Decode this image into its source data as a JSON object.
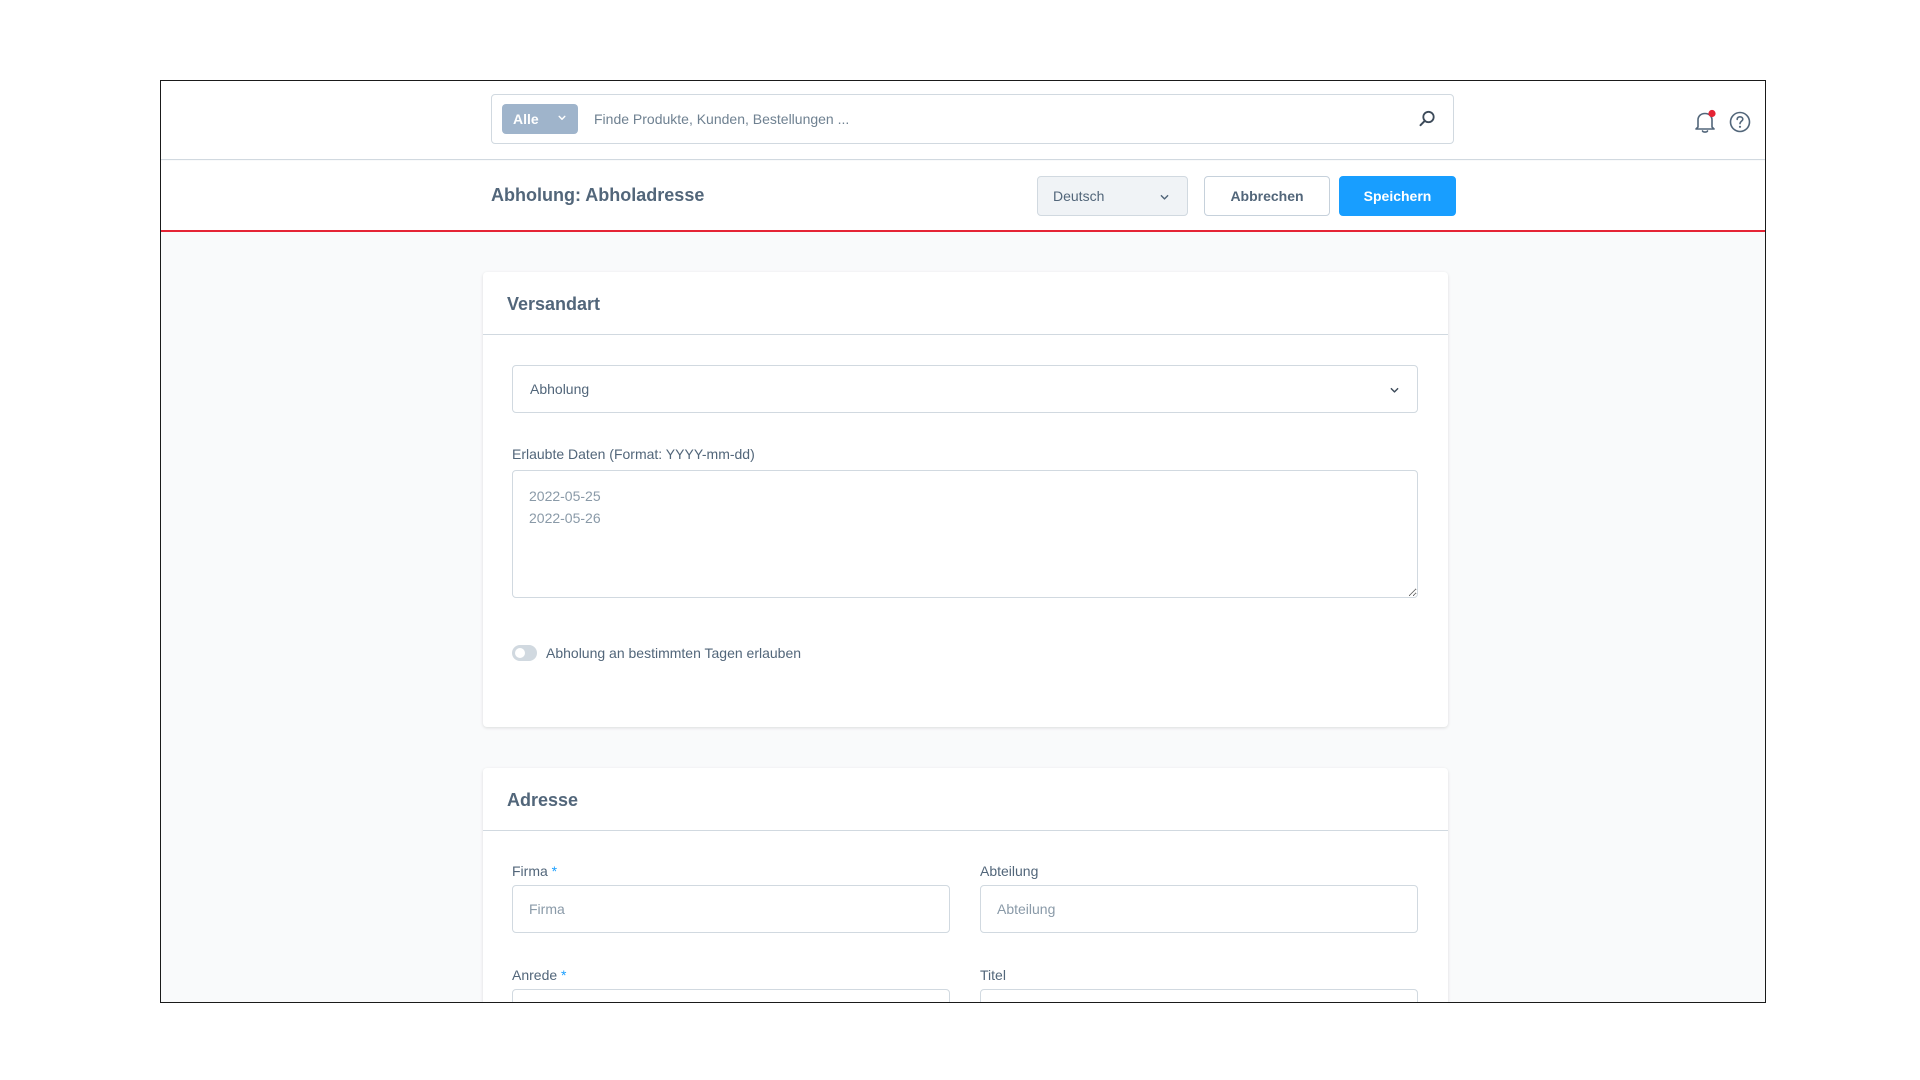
{
  "search": {
    "scope_label": "Alle",
    "placeholder": "Finde Produkte, Kunden, Bestellungen ...",
    "value": ""
  },
  "header_icons": {
    "notifications": "bell-icon",
    "help": "help-icon",
    "notification_dot_color": "#e52435"
  },
  "titlebar": {
    "title": "Abholung: Abholadresse",
    "language": "Deutsch",
    "cancel_label": "Abbrechen",
    "save_label": "Speichern"
  },
  "versandart": {
    "title": "Versandart",
    "shipping_method": "Abholung",
    "dates_label": "Erlaubte Daten (Format: YYYY-mm-dd)",
    "dates_placeholder": "2022-05-25\n2022-05-26",
    "toggle_label": "Abholung an bestimmten Tagen erlauben",
    "toggle_on": false
  },
  "adresse": {
    "title": "Adresse",
    "firma_label": "Firma",
    "firma_placeholder": "Firma",
    "abteilung_label": "Abteilung",
    "abteilung_placeholder": "Abteilung",
    "anrede_label": "Anrede",
    "titel_label": "Titel",
    "required_marker": "*"
  },
  "colors": {
    "accent": "#189eff",
    "divider_red": "#e52435",
    "text": "#52667a",
    "border": "#d1d9e0"
  }
}
